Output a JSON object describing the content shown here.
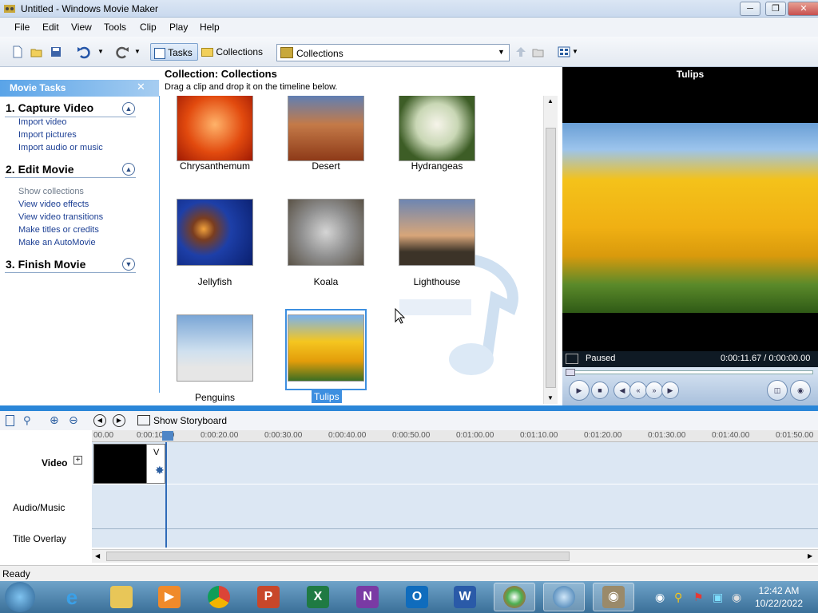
{
  "window": {
    "title": "Untitled - Windows Movie Maker"
  },
  "menu": [
    "File",
    "Edit",
    "View",
    "Tools",
    "Clip",
    "Play",
    "Help"
  ],
  "toolbar": {
    "tasks_label": "Tasks",
    "collections_label": "Collections",
    "collection_select": "Collections"
  },
  "taskpane": {
    "header": "Movie Tasks",
    "sections": [
      {
        "title": "1. Capture Video",
        "links": [
          "Import video",
          "Import pictures",
          "Import audio or music"
        ]
      },
      {
        "title": "2. Edit Movie",
        "disabled": "Show collections",
        "links": [
          "View video effects",
          "View video transitions",
          "Make titles or credits",
          "Make an AutoMovie"
        ]
      },
      {
        "title": "3. Finish Movie",
        "links": []
      }
    ]
  },
  "collection": {
    "title": "Collection: Collections",
    "subtitle": "Drag a clip and drop it on the timeline below.",
    "items": [
      "Chrysanthemum",
      "Desert",
      "Hydrangeas",
      "Jellyfish",
      "Koala",
      "Lighthouse",
      "Penguins",
      "Tulips"
    ],
    "selected": "Tulips"
  },
  "preview": {
    "title": "Tulips",
    "status": "Paused",
    "time": "0:00:11.67 / 0:00:00.00"
  },
  "timeline": {
    "storyboard_label": "Show Storyboard",
    "ruler": [
      "00.00",
      "0:00:10.00",
      "0:00:20.00",
      "0:00:30.00",
      "0:00:40.00",
      "0:00:50.00",
      "0:01:00.00",
      "0:01:10.00",
      "0:01:20.00",
      "0:01:30.00",
      "0:01:40.00",
      "0:01:50.00"
    ],
    "tracks": {
      "video": "Video",
      "audio": "Audio/Music",
      "title": "Title Overlay"
    },
    "clip_letter": "V"
  },
  "status": "Ready",
  "taskbar": {
    "time": "12:42 AM",
    "date": "10/22/2022"
  },
  "colors": {
    "accent": "#2a86d8",
    "link": "#1c3f94",
    "taskbar": "#3a6f98"
  }
}
